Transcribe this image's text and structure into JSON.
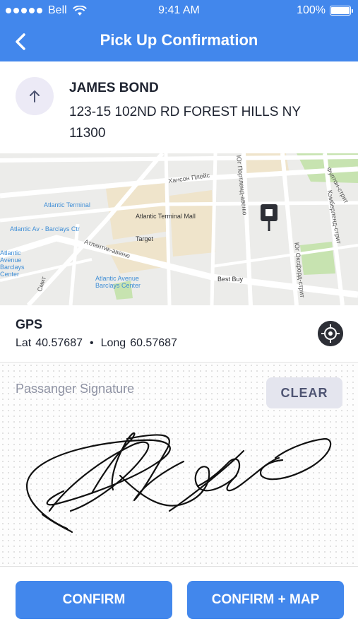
{
  "status_bar": {
    "carrier": "Bell",
    "time": "9:41 AM",
    "battery": "100%"
  },
  "nav": {
    "title": "Pick Up Confirmation",
    "back_icon": "chevron-left-icon"
  },
  "passenger": {
    "name": "JAMES BOND",
    "address": "123-15 102ND RD FOREST HILLS NY 11300",
    "icon": "arrow-up-icon"
  },
  "map": {
    "labels": {
      "street_1": "Хансон Плейс",
      "street_2": "Атлантик-авеню",
      "street_3": "Фултон-стрит",
      "street_4": "Кэмберленд-стрит",
      "street_5": "Юг Портленд-авеню",
      "street_6": "Юг Оксфорд-стрит",
      "street_7": "Смит",
      "place_1": "Atlantic Terminal",
      "place_2": "Atlantic Terminal Mall",
      "place_3": "Atlantic Av - Barclays Ctr",
      "place_4": "Target",
      "place_5": "Atlantic Avenue Barclays Center",
      "place_6": "Atlantic Avenue Barclays Center",
      "place_7": "Best Buy"
    },
    "colors": {
      "background": "#ececea",
      "roads": "#ffffff",
      "blocks": "#efe4cb",
      "parks": "#c7e3b0",
      "poi_text": "#3f8ed6"
    }
  },
  "gps": {
    "title": "GPS",
    "lat_label": "Lat",
    "lat_value": "40.57687",
    "separator": "•",
    "long_label": "Long",
    "long_value": "60.57687",
    "locate_icon": "crosshair-icon"
  },
  "signature": {
    "label": "Passanger Signature",
    "clear_label": "CLEAR"
  },
  "buttons": {
    "confirm": "CONFIRM",
    "confirm_map": "CONFIRM + MAP"
  },
  "colors": {
    "accent": "#4287ec",
    "text_dark": "#1e2330",
    "muted": "#8e92a3"
  }
}
